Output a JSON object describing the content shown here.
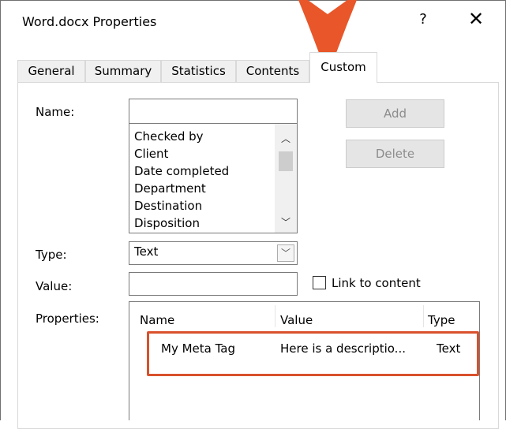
{
  "window": {
    "title": "Word.docx Properties",
    "help_glyph": "?",
    "close_glyph": "✕"
  },
  "tabs": [
    {
      "label": "General"
    },
    {
      "label": "Summary"
    },
    {
      "label": "Statistics"
    },
    {
      "label": "Contents"
    },
    {
      "label": "Custom",
      "active": true
    }
  ],
  "form": {
    "name_label": "Name:",
    "name_value": "",
    "name_list": [
      "Checked by",
      "Client",
      "Date completed",
      "Department",
      "Destination",
      "Disposition"
    ],
    "add_label": "Add",
    "delete_label": "Delete",
    "type_label": "Type:",
    "type_value": "Text",
    "value_label": "Value:",
    "value_value": "",
    "link_label": "Link to content",
    "link_checked": false,
    "properties_label": "Properties:"
  },
  "properties_table": {
    "columns": [
      "Name",
      "Value",
      "Type"
    ],
    "rows": [
      {
        "name": "My Meta Tag",
        "value": "Here is a descriptio...",
        "type": "Text"
      }
    ]
  },
  "colors": {
    "accent_arrow": "#e8562a",
    "highlight_border": "#d9512c"
  },
  "icons": {
    "scroll_up": "scroll-up-arrow-icon",
    "scroll_down": "scroll-down-arrow-icon",
    "dropdown": "chevron-down-icon",
    "pointer": "orange-pointer-arrow-icon"
  }
}
